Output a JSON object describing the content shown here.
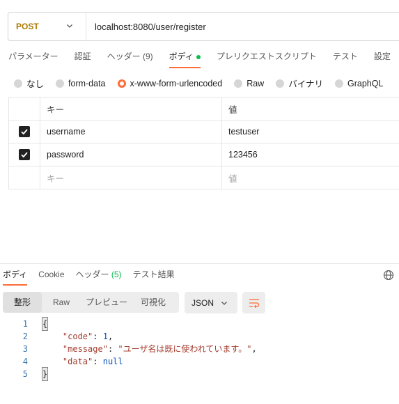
{
  "request": {
    "method": "POST",
    "url": "localhost:8080/user/register"
  },
  "request_tabs": [
    {
      "label": "パラメーター"
    },
    {
      "label": "認証"
    },
    {
      "label": "ヘッダー (9)"
    },
    {
      "label": "ボディ"
    },
    {
      "label": "プレリクエストスクリプト"
    },
    {
      "label": "テスト"
    },
    {
      "label": "設定"
    }
  ],
  "body_types": [
    {
      "label": "なし"
    },
    {
      "label": "form-data"
    },
    {
      "label": "x-www-form-urlencoded"
    },
    {
      "label": "Raw"
    },
    {
      "label": "バイナリ"
    },
    {
      "label": "GraphQL"
    }
  ],
  "params": {
    "header_key": "キー",
    "header_value": "値",
    "rows": [
      {
        "key": "username",
        "value": "testuser"
      },
      {
        "key": "password",
        "value": "123456"
      }
    ],
    "placeholder_key": "キー",
    "placeholder_value": "値"
  },
  "response_tabs": [
    {
      "label": "ボディ"
    },
    {
      "label": "Cookie"
    },
    {
      "label": "ヘッダー",
      "count": "(5)"
    },
    {
      "label": "テスト結果"
    }
  ],
  "view_modes": [
    {
      "label": "整形"
    },
    {
      "label": "Raw"
    },
    {
      "label": "プレビュー"
    },
    {
      "label": "可視化"
    }
  ],
  "format": "JSON",
  "response_json": {
    "line_numbers": [
      "1",
      "2",
      "3",
      "4",
      "5"
    ],
    "open_brace": "{",
    "close_brace": "}",
    "code_key": "\"code\"",
    "code_value": "1",
    "message_key": "\"message\"",
    "message_value": "\"ユーザ名は既に使われています。\"",
    "data_key": "\"data\"",
    "data_value": "null"
  },
  "colors": {
    "accent": "#ff6c37",
    "method": "#ad7a03",
    "success": "#0cbb52"
  }
}
